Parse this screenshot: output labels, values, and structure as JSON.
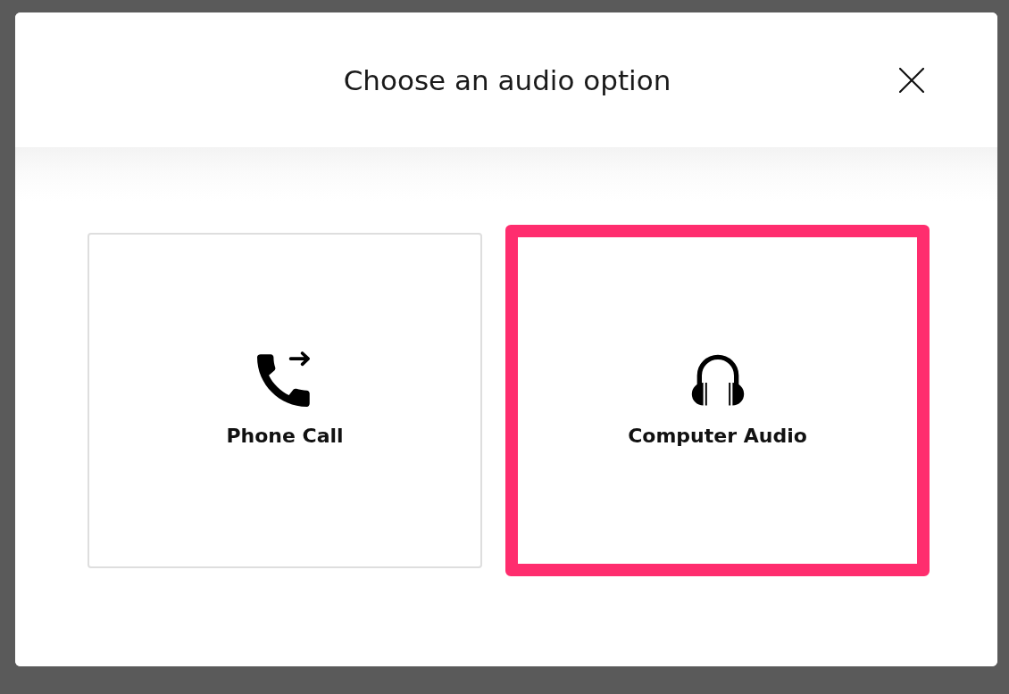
{
  "dialog": {
    "title": "Choose an audio option",
    "options": [
      {
        "label": "Phone Call",
        "kind": "phone",
        "selected": false
      },
      {
        "label": "Computer Audio",
        "kind": "headphones",
        "selected": true
      }
    ]
  }
}
